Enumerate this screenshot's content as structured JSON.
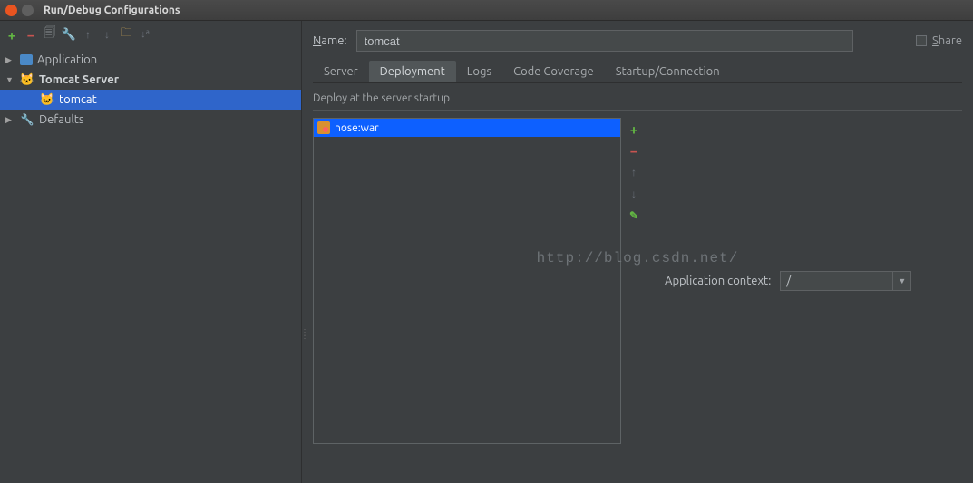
{
  "window": {
    "title": "Run/Debug Configurations"
  },
  "sidebar": {
    "items": [
      {
        "label": "Application",
        "expanded": false,
        "bold": false
      },
      {
        "label": "Tomcat Server",
        "expanded": true,
        "bold": true
      },
      {
        "label": "tomcat",
        "selected": true
      },
      {
        "label": "Defaults",
        "expanded": false,
        "bold": false
      }
    ]
  },
  "name": {
    "label": "Name:",
    "value": "tomcat"
  },
  "share": {
    "label": "Share"
  },
  "tabs": [
    {
      "label": "Server"
    },
    {
      "label": "Deployment",
      "active": true
    },
    {
      "label": "Logs"
    },
    {
      "label": "Code Coverage"
    },
    {
      "label": "Startup/Connection"
    }
  ],
  "deploy": {
    "section_label": "Deploy at the server startup",
    "artifacts": [
      {
        "label": "nose:war"
      }
    ],
    "context_label": "Application context:",
    "context_value": "/"
  },
  "watermark": "http://blog.csdn.net/"
}
